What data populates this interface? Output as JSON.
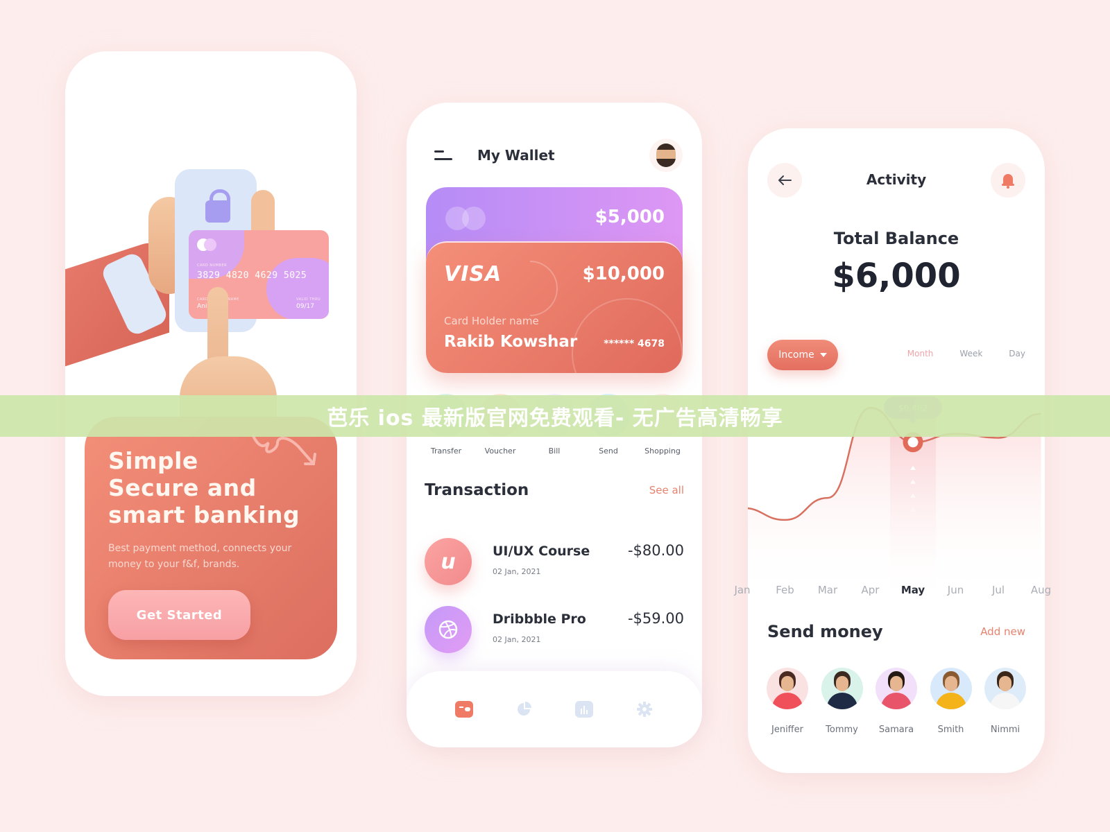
{
  "colors": {
    "background": "#fdeeed",
    "accent_coral": "#e8826e",
    "card_purple": "#c08ff5",
    "card_coral": "#ea7b69",
    "banner": "#cde6aa"
  },
  "onboarding": {
    "card": {
      "number_label": "CARD NUMBER",
      "number": "3829 4820 4629 5025",
      "holder_label": "CARD HOLDER NAME",
      "holder": "Anit  ne",
      "expiry_label": "VALID THRU",
      "expiry": "09/17"
    },
    "headline_line1": "Simple",
    "headline_line2": "Secure and",
    "headline_line3": "smart banking",
    "description": "Best payment method, connects your money to your f&f, brands.",
    "cta_label": "Get Started"
  },
  "wallet": {
    "title": "My Wallet",
    "menu_icon": "menu-icon",
    "avatar_icon": "memoji-avatar",
    "cards": [
      {
        "type": "mastercard",
        "amount": "$5,000"
      },
      {
        "type": "VISA",
        "amount": "$10,000",
        "holder_label": "Card Holder name",
        "holder": "Rakib Kowshar",
        "masked_number": "****** 4678"
      }
    ],
    "actions": [
      {
        "label": "Transfer",
        "icon": "transfer-icon",
        "color": "#d7f2e4"
      },
      {
        "label": "Voucher",
        "icon": "voucher-icon",
        "color": "#fde6d2"
      },
      {
        "label": "Bill",
        "icon": "bill-icon",
        "color": "#f4eefa"
      },
      {
        "label": "Send",
        "icon": "send-icon",
        "color": "#d6f1f6"
      },
      {
        "label": "Shopping",
        "icon": "shopping-icon",
        "color": "#fdeae6"
      }
    ],
    "transaction_title": "Transaction",
    "see_all": "See all",
    "transactions": [
      {
        "name": "UI/UX Course",
        "date": "02 Jan, 2021",
        "amount": "-$80.00",
        "icon": "udemy-icon",
        "glyph": "u"
      },
      {
        "name": "Dribbble Pro",
        "date": "02 Jan, 2021",
        "amount": "-$59.00",
        "icon": "dribbble-icon",
        "glyph": ""
      }
    ],
    "tabs": [
      {
        "name": "wallet",
        "icon": "wallet-icon",
        "active": true
      },
      {
        "name": "pie-chart",
        "icon": "pie-chart-icon",
        "active": false
      },
      {
        "name": "bar-chart",
        "icon": "bar-chart-icon",
        "active": false
      },
      {
        "name": "settings",
        "icon": "gear-icon",
        "active": false
      }
    ]
  },
  "activity": {
    "title": "Activity",
    "back_icon": "back-arrow-icon",
    "bell_icon": "bell-icon",
    "total_label": "Total Balance",
    "total_value": "$6,000",
    "filter": "Income",
    "periods": [
      "Month",
      "Week",
      "Day"
    ],
    "active_period": "Month",
    "chart_data": {
      "type": "area",
      "categories": [
        "Jan",
        "Feb",
        "Mar",
        "Apr",
        "May",
        "Jun",
        "Jul",
        "Aug"
      ],
      "values": [
        3200,
        2600,
        3700,
        8200,
        6482,
        6900,
        6700,
        7900
      ],
      "selected_category": "May",
      "selected_tooltip": "$6,482",
      "ylim": [
        0,
        9000
      ]
    },
    "send_money_title": "Send money",
    "add_new": "Add new",
    "contacts": [
      {
        "name": "Jeniffer",
        "bg": "#fbe2e2",
        "shirt": "#f0505a",
        "hair": "#4a2a20"
      },
      {
        "name": "Tommy",
        "bg": "#d9f2ea",
        "shirt": "#1f2a44",
        "hair": "#3a2a20"
      },
      {
        "name": "Samara",
        "bg": "#f2e0fb",
        "shirt": "#e8546a",
        "hair": "#231812"
      },
      {
        "name": "Smith",
        "bg": "#d7e9fb",
        "shirt": "#f4b318",
        "hair": "#8a5a30"
      },
      {
        "name": "Nimmi",
        "bg": "#deecfa",
        "shirt": "#f6f6f6",
        "hair": "#3a2618"
      }
    ]
  },
  "banner": {
    "text": "芭乐 ios 最新版官网免费观看- 无广告高清畅享"
  }
}
